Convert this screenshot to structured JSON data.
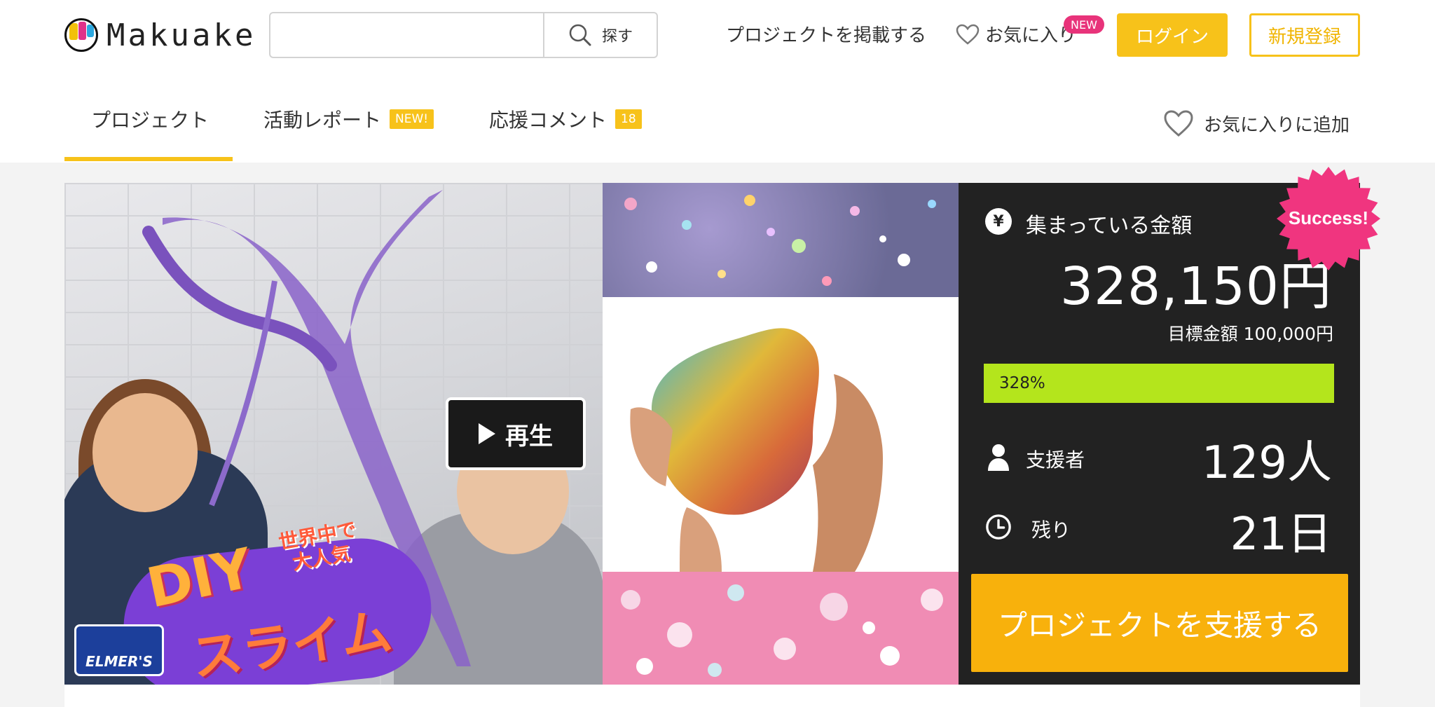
{
  "header": {
    "logo_text": "Makuake",
    "search": {
      "placeholder": "",
      "button_label": "探す"
    },
    "nav_post": "プロジェクトを掲載する",
    "nav_favorites": "お気に入り",
    "new_badge": "NEW",
    "login": "ログイン",
    "register": "新規登録"
  },
  "tabs": [
    {
      "label": "プロジェクト",
      "active": true
    },
    {
      "label": "活動レポート",
      "badge": "NEW!"
    },
    {
      "label": "応援コメント",
      "badge": "18"
    }
  ],
  "add_favorite": "お気に入りに追加",
  "hero": {
    "play_label": "再生",
    "overlay_world": "世界中で\n大人気",
    "overlay_diy": "DIY",
    "overlay_slime": "スライム",
    "brand": "ELMER'S"
  },
  "funding": {
    "collected_label": "集まっている金額",
    "amount": "328,150円",
    "goal": "目標金額 100,000円",
    "progress_label": "328%",
    "progress_fraction": 1.0,
    "backers_label": "支援者",
    "backers": "129人",
    "remaining_label": "残り",
    "remaining": "21日",
    "support_button": "プロジェクトを支援する",
    "success_badge": "Success!"
  },
  "colors": {
    "accent": "#f7c21a",
    "support_button": "#f8b10c",
    "progress": "#b4e51c",
    "new_badge": "#e8337a",
    "success_badge": "#f0357f",
    "panel_bg": "#222222"
  }
}
